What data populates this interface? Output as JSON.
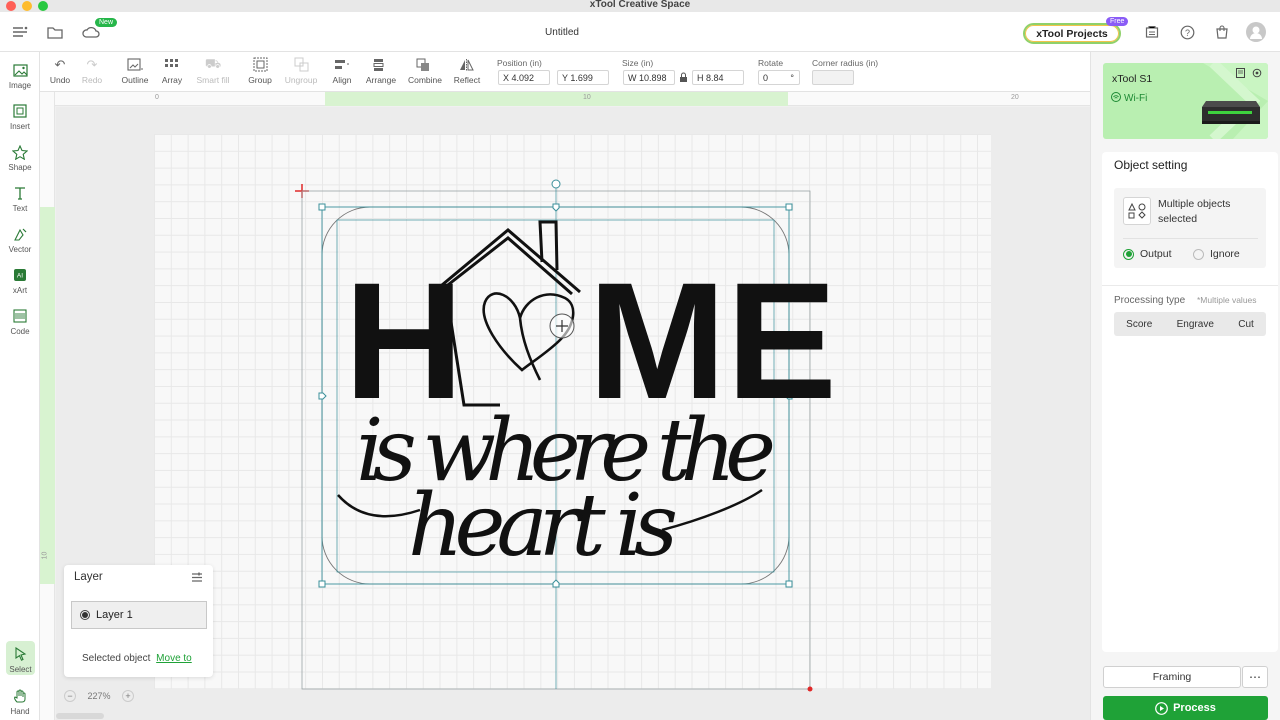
{
  "window": {
    "app_title": "xTool Creative Space"
  },
  "header": {
    "doc_title": "Untitled",
    "new_badge": "New",
    "projects_label": "xTool Projects",
    "free_badge": "Free"
  },
  "toolbar": {
    "undo": "Undo",
    "redo": "Redo",
    "outline": "Outline",
    "array": "Array",
    "smart_fill": "Smart fill",
    "group": "Group",
    "ungroup": "Ungroup",
    "align": "Align",
    "arrange": "Arrange",
    "combine": "Combine",
    "reflect": "Reflect",
    "position_label": "Position (in)",
    "pos_x": "X 4.092",
    "pos_y": "Y 1.699",
    "size_label": "Size (in)",
    "size_w": "W 10.898",
    "size_h": "H 8.84",
    "rotate_label": "Rotate",
    "rotate_value": "0",
    "rotate_unit": "°",
    "corner_label": "Corner radius (in)",
    "corner_value": ""
  },
  "sidebar": {
    "items": [
      {
        "label": "Image",
        "icon": "image-icon"
      },
      {
        "label": "Insert",
        "icon": "insert-icon"
      },
      {
        "label": "Shape",
        "icon": "shape-icon"
      },
      {
        "label": "Text",
        "icon": "text-icon"
      },
      {
        "label": "Vector",
        "icon": "vector-icon"
      },
      {
        "label": "xArt",
        "icon": "xart-icon"
      },
      {
        "label": "Code",
        "icon": "code-icon"
      }
    ],
    "select": "Select",
    "hand": "Hand"
  },
  "rulers": {
    "top_0": "0",
    "top_10": "10",
    "top_20": "20",
    "left_10": "10"
  },
  "device": {
    "name": "xTool S1",
    "status": "Wi-Fi"
  },
  "object_setting": {
    "title": "Object setting",
    "selection": "Multiple objects selected",
    "output": "Output",
    "ignore": "Ignore",
    "processing_label": "Processing type",
    "processing_note": "*Multiple values",
    "types": [
      "Score",
      "Engrave",
      "Cut"
    ]
  },
  "actions": {
    "framing": "Framing",
    "more": "⋯",
    "process": "Process"
  },
  "layer_panel": {
    "title": "Layer",
    "layer_name": "Layer 1",
    "selected_text": "Selected object",
    "move_to": "Move to"
  },
  "zoom": {
    "minus": "−",
    "value": "227%",
    "plus": "+"
  },
  "design": {
    "big_h": "H",
    "big_me": "ME",
    "line2": "is where the",
    "line3": "heart is"
  },
  "colors": {
    "accent": "#1fa237",
    "selection": "#3a8f9a",
    "device_bg": "#b9efb1"
  }
}
